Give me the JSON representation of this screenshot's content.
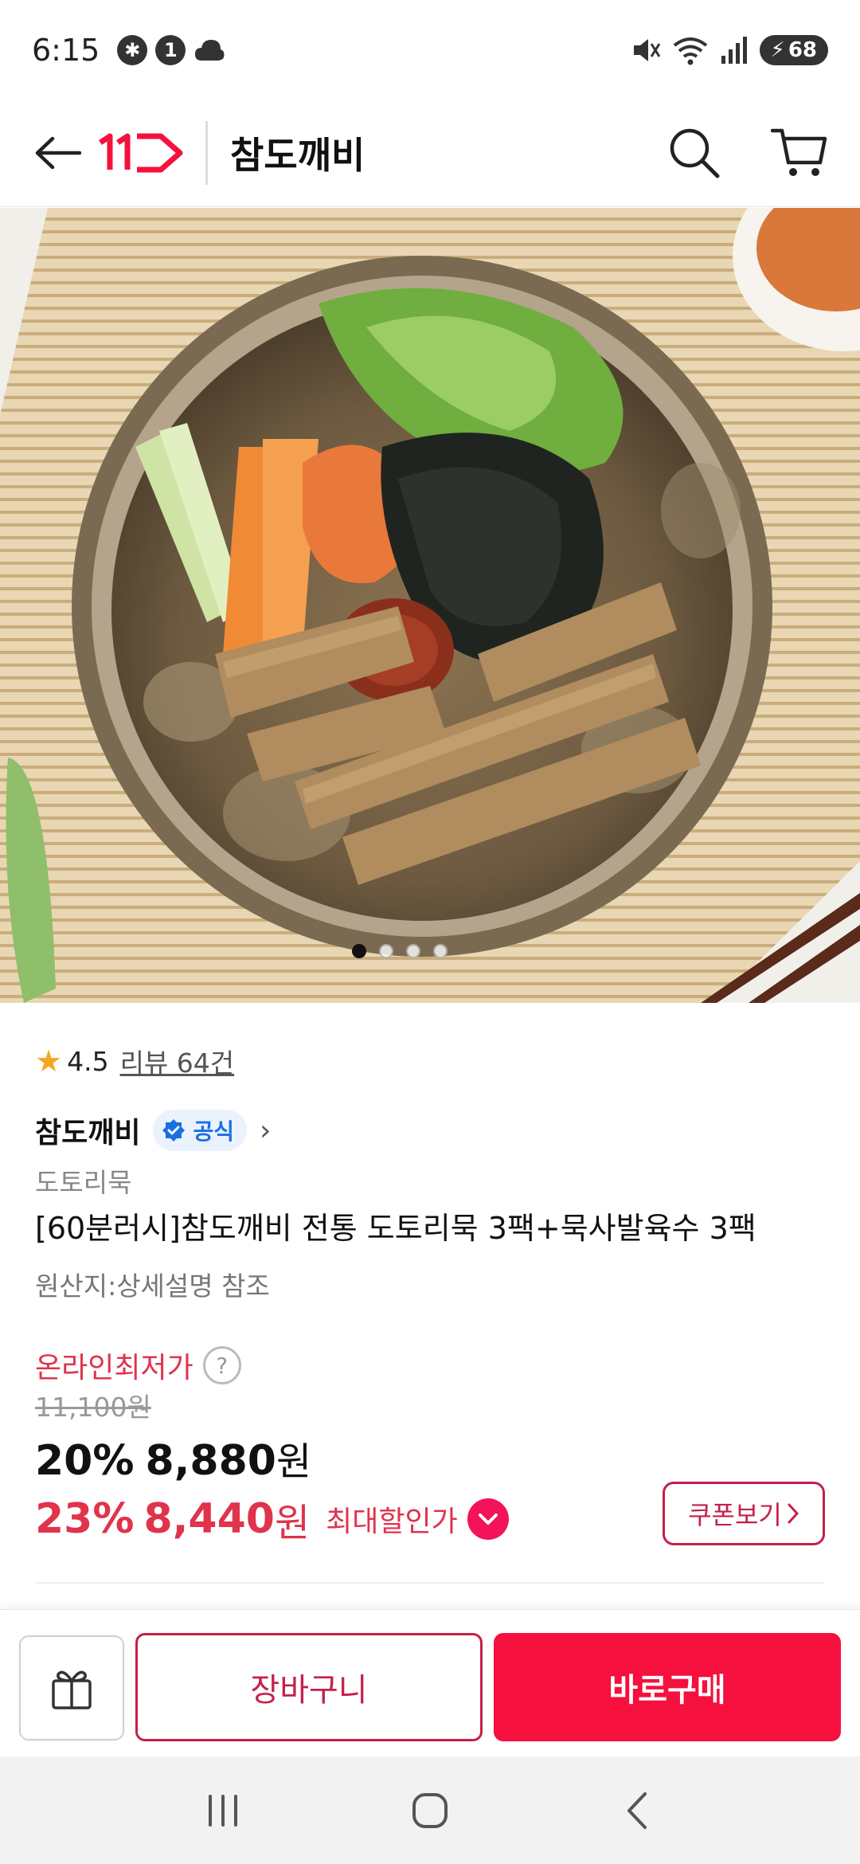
{
  "status_bar": {
    "time": "6:15",
    "notification_count": "1",
    "battery": "68"
  },
  "header": {
    "brand_logo": "11",
    "title": "참도깨비"
  },
  "gallery": {
    "total_images": 4,
    "current_index": 1
  },
  "product": {
    "rating": "4.5",
    "review_link": "리뷰 64건",
    "seller_name": "참도깨비",
    "official_badge": "공식",
    "category": "도토리묵",
    "title": "[60분러시]참도깨비 전통 도토리묵 3팩+묵사발육수 3팩",
    "origin": "원산지:상세설명 참조"
  },
  "pricing": {
    "online_label": "온라인최저가",
    "original_price": "11,100원",
    "discount_rate": "20%",
    "sale_price": "8,880",
    "won": "원",
    "best_discount_rate": "23%",
    "best_price": "8,440",
    "best_label": "최대할인가",
    "coupon_button": "쿠폰보기"
  },
  "bottom_bar": {
    "cart_label": "장바구니",
    "buy_label": "바로구매"
  },
  "colors": {
    "brand_red": "#f5103d",
    "accent_pink": "#e0334c",
    "official_blue": "#1a6fe0",
    "star": "#f5a623"
  }
}
